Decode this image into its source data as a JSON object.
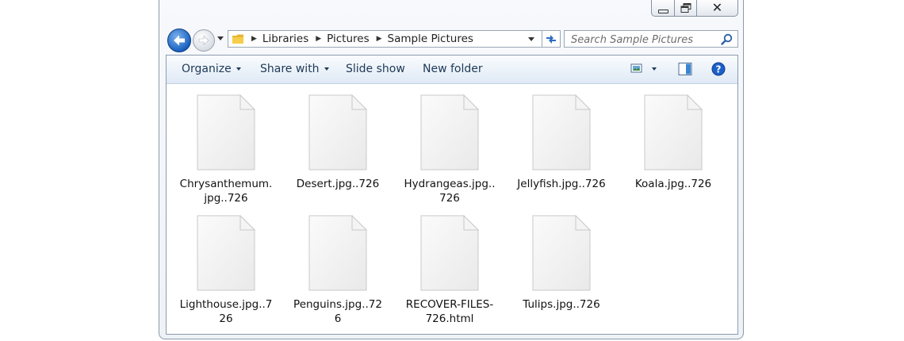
{
  "window": {
    "caption": {
      "minimize": "minimize",
      "maximize": "maximize",
      "close": "close"
    }
  },
  "nav": {
    "breadcrumbs": [
      "Libraries",
      "Pictures",
      "Sample Pictures"
    ],
    "search_placeholder": "Search Sample Pictures"
  },
  "toolbar": {
    "organize": "Organize",
    "share_with": "Share with",
    "slide_show": "Slide show",
    "new_folder": "New folder"
  },
  "files": [
    {
      "name": "Chrysanthemum.jpg..726"
    },
    {
      "name": "Desert.jpg..726"
    },
    {
      "name": "Hydrangeas.jpg..726"
    },
    {
      "name": "Jellyfish.jpg..726"
    },
    {
      "name": "Koala.jpg..726"
    },
    {
      "name": "Lighthouse.jpg..726"
    },
    {
      "name": "Penguins.jpg..726"
    },
    {
      "name": "RECOVER-FILES-726.html"
    },
    {
      "name": "Tulips.jpg..726"
    }
  ],
  "colors": {
    "accent": "#1a62c0",
    "toolbar_text": "#1e3956",
    "help": "#1c5fc9"
  }
}
